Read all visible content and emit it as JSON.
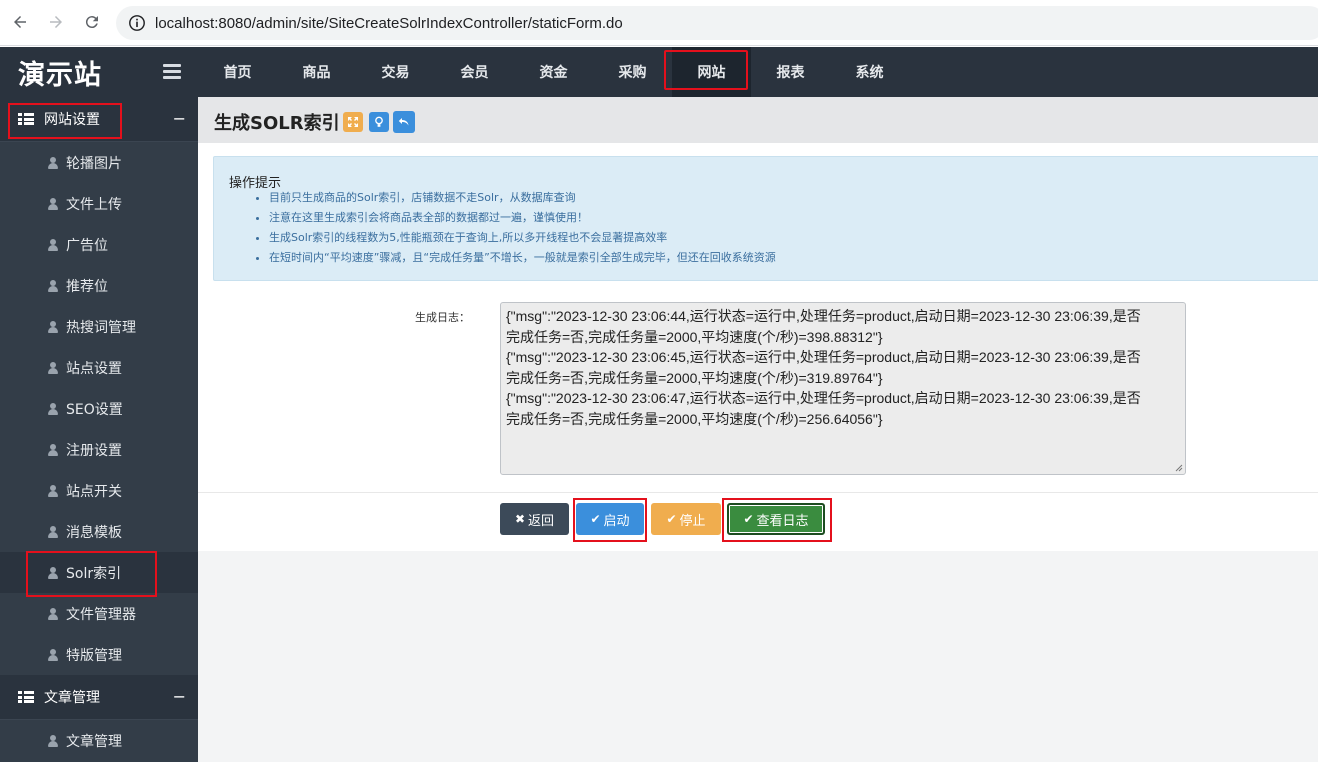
{
  "browser": {
    "url": "localhost:8080/admin/site/SiteCreateSolrIndexController/staticForm.do"
  },
  "header": {
    "logo": "演示站",
    "nav": [
      "首页",
      "商品",
      "交易",
      "会员",
      "资金",
      "采购",
      "网站",
      "报表",
      "系统"
    ],
    "active_nav": "网站"
  },
  "sidebar": {
    "group1": {
      "label": "网站设置",
      "toggle": "−",
      "items": [
        "轮播图片",
        "文件上传",
        "广告位",
        "推荐位",
        "热搜词管理",
        "站点设置",
        "SEO设置",
        "注册设置",
        "站点开关",
        "消息模板",
        "Solr索引",
        "文件管理器",
        "特版管理"
      ],
      "active": "Solr索引"
    },
    "group2": {
      "label": "文章管理",
      "toggle": "−",
      "items": [
        "文章管理"
      ]
    }
  },
  "page": {
    "title": "生成SOLR索引"
  },
  "tips": {
    "title": "操作提示",
    "items": [
      "目前只生成商品的Solr索引，店铺数据不走Solr，从数据库查询",
      "注意在这里生成索引会将商品表全部的数据都过一遍，谨慎使用！",
      "生成Solr索引的线程数为5,性能瓶颈在于查询上,所以多开线程也不会显著提高效率",
      "在短时间内“平均速度”骤减，且“完成任务量”不增长，一般就是索引全部生成完毕，但还在回收系统资源"
    ]
  },
  "log": {
    "label": "生成日志：",
    "lines": [
      "{\"msg\":\"2023-12-30 23:06:44,运行状态=运行中,处理任务=product,启动日期=2023-12-30 23:06:39,是否",
      "完成任务=否,完成任务量=2000,平均速度(个/秒)=398.88312\"}",
      "{\"msg\":\"2023-12-30 23:06:45,运行状态=运行中,处理任务=product,启动日期=2023-12-30 23:06:39,是否",
      "完成任务=否,完成任务量=2000,平均速度(个/秒)=319.89764\"}",
      "{\"msg\":\"2023-12-30 23:06:47,运行状态=运行中,处理任务=product,启动日期=2023-12-30 23:06:39,是否",
      "完成任务=否,完成任务量=2000,平均速度(个/秒)=256.64056\"}"
    ]
  },
  "buttons": {
    "back": "返回",
    "start": "启动",
    "stop": "停止",
    "view_log": "查看日志"
  },
  "colors": {
    "header_bg": "#2a333e",
    "sidebar_bg": "#333d48",
    "highlight": "#e4101c",
    "start_btn": "#3b8fdc",
    "stop_btn": "#f0ad4e",
    "log_btn": "#3a8c3f",
    "back_btn": "#3c4a59"
  }
}
